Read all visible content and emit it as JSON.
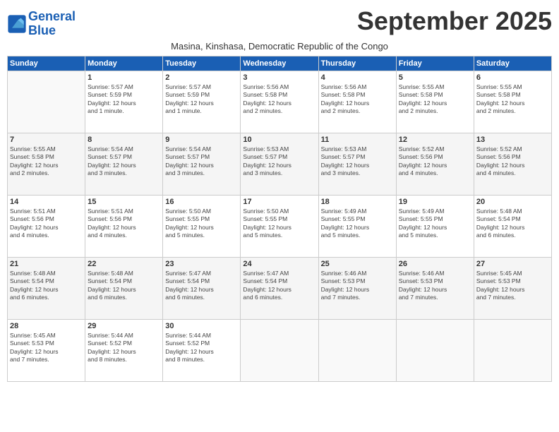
{
  "header": {
    "logo_line1": "General",
    "logo_line2": "Blue",
    "month": "September 2025",
    "location": "Masina, Kinshasa, Democratic Republic of the Congo"
  },
  "weekdays": [
    "Sunday",
    "Monday",
    "Tuesday",
    "Wednesday",
    "Thursday",
    "Friday",
    "Saturday"
  ],
  "weeks": [
    [
      {
        "day": "",
        "text": ""
      },
      {
        "day": "1",
        "text": "Sunrise: 5:57 AM\nSunset: 5:59 PM\nDaylight: 12 hours\nand 1 minute."
      },
      {
        "day": "2",
        "text": "Sunrise: 5:57 AM\nSunset: 5:59 PM\nDaylight: 12 hours\nand 1 minute."
      },
      {
        "day": "3",
        "text": "Sunrise: 5:56 AM\nSunset: 5:58 PM\nDaylight: 12 hours\nand 2 minutes."
      },
      {
        "day": "4",
        "text": "Sunrise: 5:56 AM\nSunset: 5:58 PM\nDaylight: 12 hours\nand 2 minutes."
      },
      {
        "day": "5",
        "text": "Sunrise: 5:55 AM\nSunset: 5:58 PM\nDaylight: 12 hours\nand 2 minutes."
      },
      {
        "day": "6",
        "text": "Sunrise: 5:55 AM\nSunset: 5:58 PM\nDaylight: 12 hours\nand 2 minutes."
      }
    ],
    [
      {
        "day": "7",
        "text": "Sunrise: 5:55 AM\nSunset: 5:58 PM\nDaylight: 12 hours\nand 2 minutes."
      },
      {
        "day": "8",
        "text": "Sunrise: 5:54 AM\nSunset: 5:57 PM\nDaylight: 12 hours\nand 3 minutes."
      },
      {
        "day": "9",
        "text": "Sunrise: 5:54 AM\nSunset: 5:57 PM\nDaylight: 12 hours\nand 3 minutes."
      },
      {
        "day": "10",
        "text": "Sunrise: 5:53 AM\nSunset: 5:57 PM\nDaylight: 12 hours\nand 3 minutes."
      },
      {
        "day": "11",
        "text": "Sunrise: 5:53 AM\nSunset: 5:57 PM\nDaylight: 12 hours\nand 3 minutes."
      },
      {
        "day": "12",
        "text": "Sunrise: 5:52 AM\nSunset: 5:56 PM\nDaylight: 12 hours\nand 4 minutes."
      },
      {
        "day": "13",
        "text": "Sunrise: 5:52 AM\nSunset: 5:56 PM\nDaylight: 12 hours\nand 4 minutes."
      }
    ],
    [
      {
        "day": "14",
        "text": "Sunrise: 5:51 AM\nSunset: 5:56 PM\nDaylight: 12 hours\nand 4 minutes."
      },
      {
        "day": "15",
        "text": "Sunrise: 5:51 AM\nSunset: 5:56 PM\nDaylight: 12 hours\nand 4 minutes."
      },
      {
        "day": "16",
        "text": "Sunrise: 5:50 AM\nSunset: 5:55 PM\nDaylight: 12 hours\nand 5 minutes."
      },
      {
        "day": "17",
        "text": "Sunrise: 5:50 AM\nSunset: 5:55 PM\nDaylight: 12 hours\nand 5 minutes."
      },
      {
        "day": "18",
        "text": "Sunrise: 5:49 AM\nSunset: 5:55 PM\nDaylight: 12 hours\nand 5 minutes."
      },
      {
        "day": "19",
        "text": "Sunrise: 5:49 AM\nSunset: 5:55 PM\nDaylight: 12 hours\nand 5 minutes."
      },
      {
        "day": "20",
        "text": "Sunrise: 5:48 AM\nSunset: 5:54 PM\nDaylight: 12 hours\nand 6 minutes."
      }
    ],
    [
      {
        "day": "21",
        "text": "Sunrise: 5:48 AM\nSunset: 5:54 PM\nDaylight: 12 hours\nand 6 minutes."
      },
      {
        "day": "22",
        "text": "Sunrise: 5:48 AM\nSunset: 5:54 PM\nDaylight: 12 hours\nand 6 minutes."
      },
      {
        "day": "23",
        "text": "Sunrise: 5:47 AM\nSunset: 5:54 PM\nDaylight: 12 hours\nand 6 minutes."
      },
      {
        "day": "24",
        "text": "Sunrise: 5:47 AM\nSunset: 5:54 PM\nDaylight: 12 hours\nand 6 minutes."
      },
      {
        "day": "25",
        "text": "Sunrise: 5:46 AM\nSunset: 5:53 PM\nDaylight: 12 hours\nand 7 minutes."
      },
      {
        "day": "26",
        "text": "Sunrise: 5:46 AM\nSunset: 5:53 PM\nDaylight: 12 hours\nand 7 minutes."
      },
      {
        "day": "27",
        "text": "Sunrise: 5:45 AM\nSunset: 5:53 PM\nDaylight: 12 hours\nand 7 minutes."
      }
    ],
    [
      {
        "day": "28",
        "text": "Sunrise: 5:45 AM\nSunset: 5:53 PM\nDaylight: 12 hours\nand 7 minutes."
      },
      {
        "day": "29",
        "text": "Sunrise: 5:44 AM\nSunset: 5:52 PM\nDaylight: 12 hours\nand 8 minutes."
      },
      {
        "day": "30",
        "text": "Sunrise: 5:44 AM\nSunset: 5:52 PM\nDaylight: 12 hours\nand 8 minutes."
      },
      {
        "day": "",
        "text": ""
      },
      {
        "day": "",
        "text": ""
      },
      {
        "day": "",
        "text": ""
      },
      {
        "day": "",
        "text": ""
      }
    ]
  ]
}
